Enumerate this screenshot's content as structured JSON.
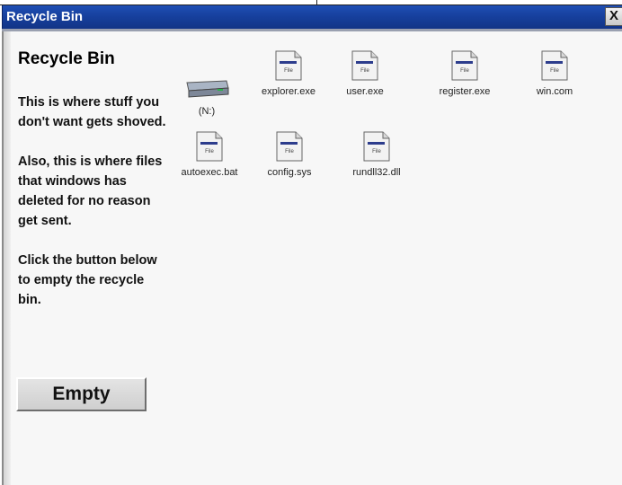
{
  "window": {
    "title": "Recycle Bin",
    "close_label": "X"
  },
  "sidebar": {
    "heading": "Recycle Bin",
    "paragraphs": [
      "This is where stuff you don't want gets shoved.",
      "Also, this is where files that windows has deleted for no reason get sent.",
      "Click the button below to empty the recycle bin."
    ],
    "empty_button_label": "Empty"
  },
  "files": [
    {
      "name": "(N:)",
      "icon": "drive-icon"
    },
    {
      "name": "explorer.exe",
      "icon": "file-icon"
    },
    {
      "name": "user.exe",
      "icon": "file-icon"
    },
    {
      "name": "register.exe",
      "icon": "file-icon"
    },
    {
      "name": "win.com",
      "icon": "file-icon"
    },
    {
      "name": "autoexec.bat",
      "icon": "file-icon"
    },
    {
      "name": "config.sys",
      "icon": "file-icon"
    },
    {
      "name": "rundll32.dll",
      "icon": "file-icon"
    }
  ],
  "file_icon_text": "File",
  "colors": {
    "titlebar": "#163f9c",
    "title_text": "#ffffff",
    "background": "#f7f7f7"
  }
}
